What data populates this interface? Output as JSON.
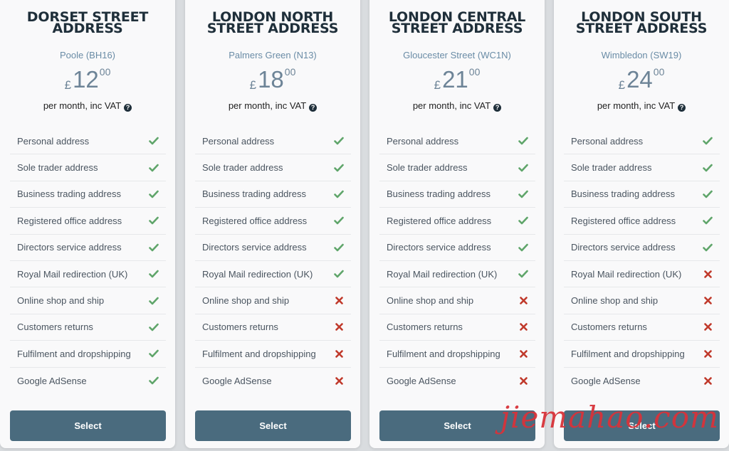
{
  "check_color": "#5fa56a",
  "cross_color": "#c0392b",
  "button_color": "#4a6b7e",
  "feature_labels": [
    "Personal address",
    "Sole trader address",
    "Business trading address",
    "Registered office address",
    "Directors service address",
    "Royal Mail redirection (UK)",
    "Online shop and ship",
    "Customers returns",
    "Fulfilment and dropshipping",
    "Google AdSense"
  ],
  "plans": [
    {
      "title_line1": "DORSET STREET",
      "title_line2": "ADDRESS",
      "location": "Poole (BH16)",
      "currency": "£",
      "price": "12",
      "pence": "00",
      "period": "per month, inc VAT",
      "included": [
        true,
        true,
        true,
        true,
        true,
        true,
        true,
        true,
        true,
        true
      ],
      "select_label": "Select"
    },
    {
      "title_line1": "LONDON NORTH",
      "title_line2": "STREET ADDRESS",
      "location": "Palmers Green (N13)",
      "currency": "£",
      "price": "18",
      "pence": "00",
      "period": "per month, inc VAT",
      "included": [
        true,
        true,
        true,
        true,
        true,
        true,
        false,
        false,
        false,
        false
      ],
      "select_label": "Select"
    },
    {
      "title_line1": "LONDON CENTRAL",
      "title_line2": "STREET ADDRESS",
      "location": "Gloucester Street (WC1N)",
      "currency": "£",
      "price": "21",
      "pence": "00",
      "period": "per month, inc VAT",
      "included": [
        true,
        true,
        true,
        true,
        true,
        true,
        false,
        false,
        false,
        false
      ],
      "select_label": "Select"
    },
    {
      "title_line1": "LONDON SOUTH",
      "title_line2": "STREET ADDRESS",
      "location": "Wimbledon (SW19)",
      "currency": "£",
      "price": "24",
      "pence": "00",
      "period": "per month, inc VAT",
      "included": [
        true,
        true,
        true,
        true,
        true,
        false,
        false,
        false,
        false,
        false
      ],
      "select_label": "Select"
    }
  ],
  "watermark": "jiemahao.com"
}
